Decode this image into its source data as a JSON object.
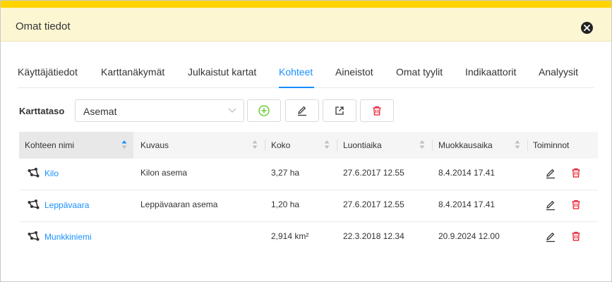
{
  "dialog": {
    "title": "Omat tiedot",
    "accent_color": "#ffd400",
    "header_bg": "#fdf6d3",
    "close_icon": "close-circle-icon"
  },
  "tabs": [
    {
      "label": "Käyttäjätiedot",
      "active": false
    },
    {
      "label": "Karttanäkymät",
      "active": false
    },
    {
      "label": "Julkaistut kartat",
      "active": false
    },
    {
      "label": "Kohteet",
      "active": true
    },
    {
      "label": "Aineistot",
      "active": false
    },
    {
      "label": "Omat tyylit",
      "active": false
    },
    {
      "label": "Indikaattorit",
      "active": false
    },
    {
      "label": "Analyysit",
      "active": false
    }
  ],
  "toolbar": {
    "layer_label": "Karttataso",
    "layer_value": "Asemat",
    "buttons": [
      {
        "icon": "add-circle-icon",
        "color": "#52c41a"
      },
      {
        "icon": "edit-pen-icon",
        "color": "#333333"
      },
      {
        "icon": "export-icon",
        "color": "#333333"
      },
      {
        "icon": "delete-trash-icon",
        "color": "#e8182b"
      }
    ]
  },
  "table": {
    "columns": [
      {
        "label": "Kohteen nimi",
        "sorted": "ascending"
      },
      {
        "label": "Kuvaus",
        "sorted": "none"
      },
      {
        "label": "Koko",
        "sorted": "none"
      },
      {
        "label": "Luontiaika",
        "sorted": "none"
      },
      {
        "label": "Muokkausaika",
        "sorted": "none"
      },
      {
        "label": "Toiminnot",
        "sorted": "none"
      }
    ],
    "rows": [
      {
        "name": "Kilo",
        "description": "Kilon asema",
        "size": "3,27 ha",
        "created": "27.6.2017 12.55",
        "modified": "8.4.2014 17.41"
      },
      {
        "name": "Leppävaara",
        "description": "Leppävaaran asema",
        "size": "1,20 ha",
        "created": "27.6.2017 12.55",
        "modified": "8.4.2014 17.41"
      },
      {
        "name": "Munkkiniemi",
        "description": "",
        "size": "2,914 km²",
        "created": "22.3.2018 12.34",
        "modified": "20.9.2024 12.00"
      }
    ],
    "row_icon": "feature-polygon-icon",
    "action_icons": [
      "edit-pen-icon",
      "delete-trash-icon"
    ],
    "link_color": "#1890ff",
    "delete_color": "#e8182b"
  }
}
